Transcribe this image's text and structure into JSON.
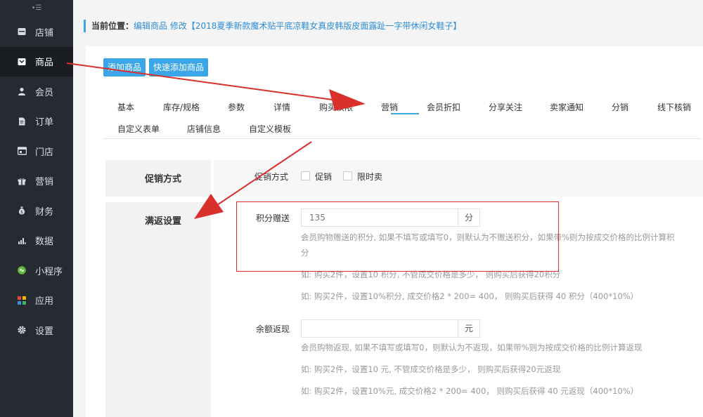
{
  "sidebar": {
    "toggle_glyph": "•☰",
    "items": [
      {
        "label": "店铺",
        "icon": "store-icon"
      },
      {
        "label": "商品",
        "icon": "goods-icon",
        "active": true
      },
      {
        "label": "会员",
        "icon": "member-icon"
      },
      {
        "label": "订单",
        "icon": "order-icon"
      },
      {
        "label": "门店",
        "icon": "shop-icon"
      },
      {
        "label": "营销",
        "icon": "gift-icon"
      },
      {
        "label": "财务",
        "icon": "money-bag-icon"
      },
      {
        "label": "数据",
        "icon": "bar-chart-icon"
      },
      {
        "label": "小程序",
        "icon": "mini-program-icon"
      },
      {
        "label": "应用",
        "icon": "apps-grid-icon"
      },
      {
        "label": "设置",
        "icon": "gear-icon"
      }
    ]
  },
  "breadcrumb": {
    "label": "当前位置：",
    "link": "编辑商品 修改【2018夏季新款魔术贴平底凉鞋女真皮韩版皮面露趾一字带休闲女鞋子】"
  },
  "toolbar": {
    "add_goods": "添加商品",
    "quick_add_goods": "快速添加商品"
  },
  "tabs": {
    "row1": [
      "基本",
      "库存/规格",
      "参数",
      "详情",
      "购买权限",
      "营销",
      "会员折扣",
      "分享关注",
      "卖家通知",
      "分销",
      "线下核销"
    ],
    "row2": [
      "自定义表单",
      "店铺信息",
      "自定义模板"
    ],
    "active": "营销"
  },
  "promo": {
    "section_title": "促销方式",
    "field_label": "促销方式",
    "options": [
      "促销",
      "限时卖"
    ]
  },
  "rebate": {
    "section_title": "满返设置",
    "points": {
      "label": "积分赠送",
      "value": "135",
      "unit": "分",
      "hint1": "会员购物赠送的积分, 如果不填写或填写0，则默认为不赠送积分，如果带%则为按成交价格的比例计算积",
      "hint1b": "分",
      "hint2": "如: 购买2件，设置10 积分, 不管成交价格是多少， 则购买后获得20积分",
      "hint3": "如: 购买2件，设置10%积分, 成交价格2 * 200= 400， 则购买后获得 40 积分（400*10%）"
    },
    "balance": {
      "label": "余额返现",
      "value": "",
      "unit": "元",
      "hint1": "会员购物返现, 如果不填写或填写0，则默认为不返现，如果带%则为按成交价格的比例计算返现",
      "hint2": "如: 购买2件，设置10 元, 不管成交价格是多少， 则购买后获得20元返现",
      "hint3": "如: 购买2件，设置10%元, 成交价格2 * 200= 400， 则购买后获得 40 元返现（400*10%）"
    }
  },
  "colors": {
    "accent": "#3aa6e8",
    "sidebar_bg": "#262b32",
    "annotation_red": "#d9302c"
  }
}
